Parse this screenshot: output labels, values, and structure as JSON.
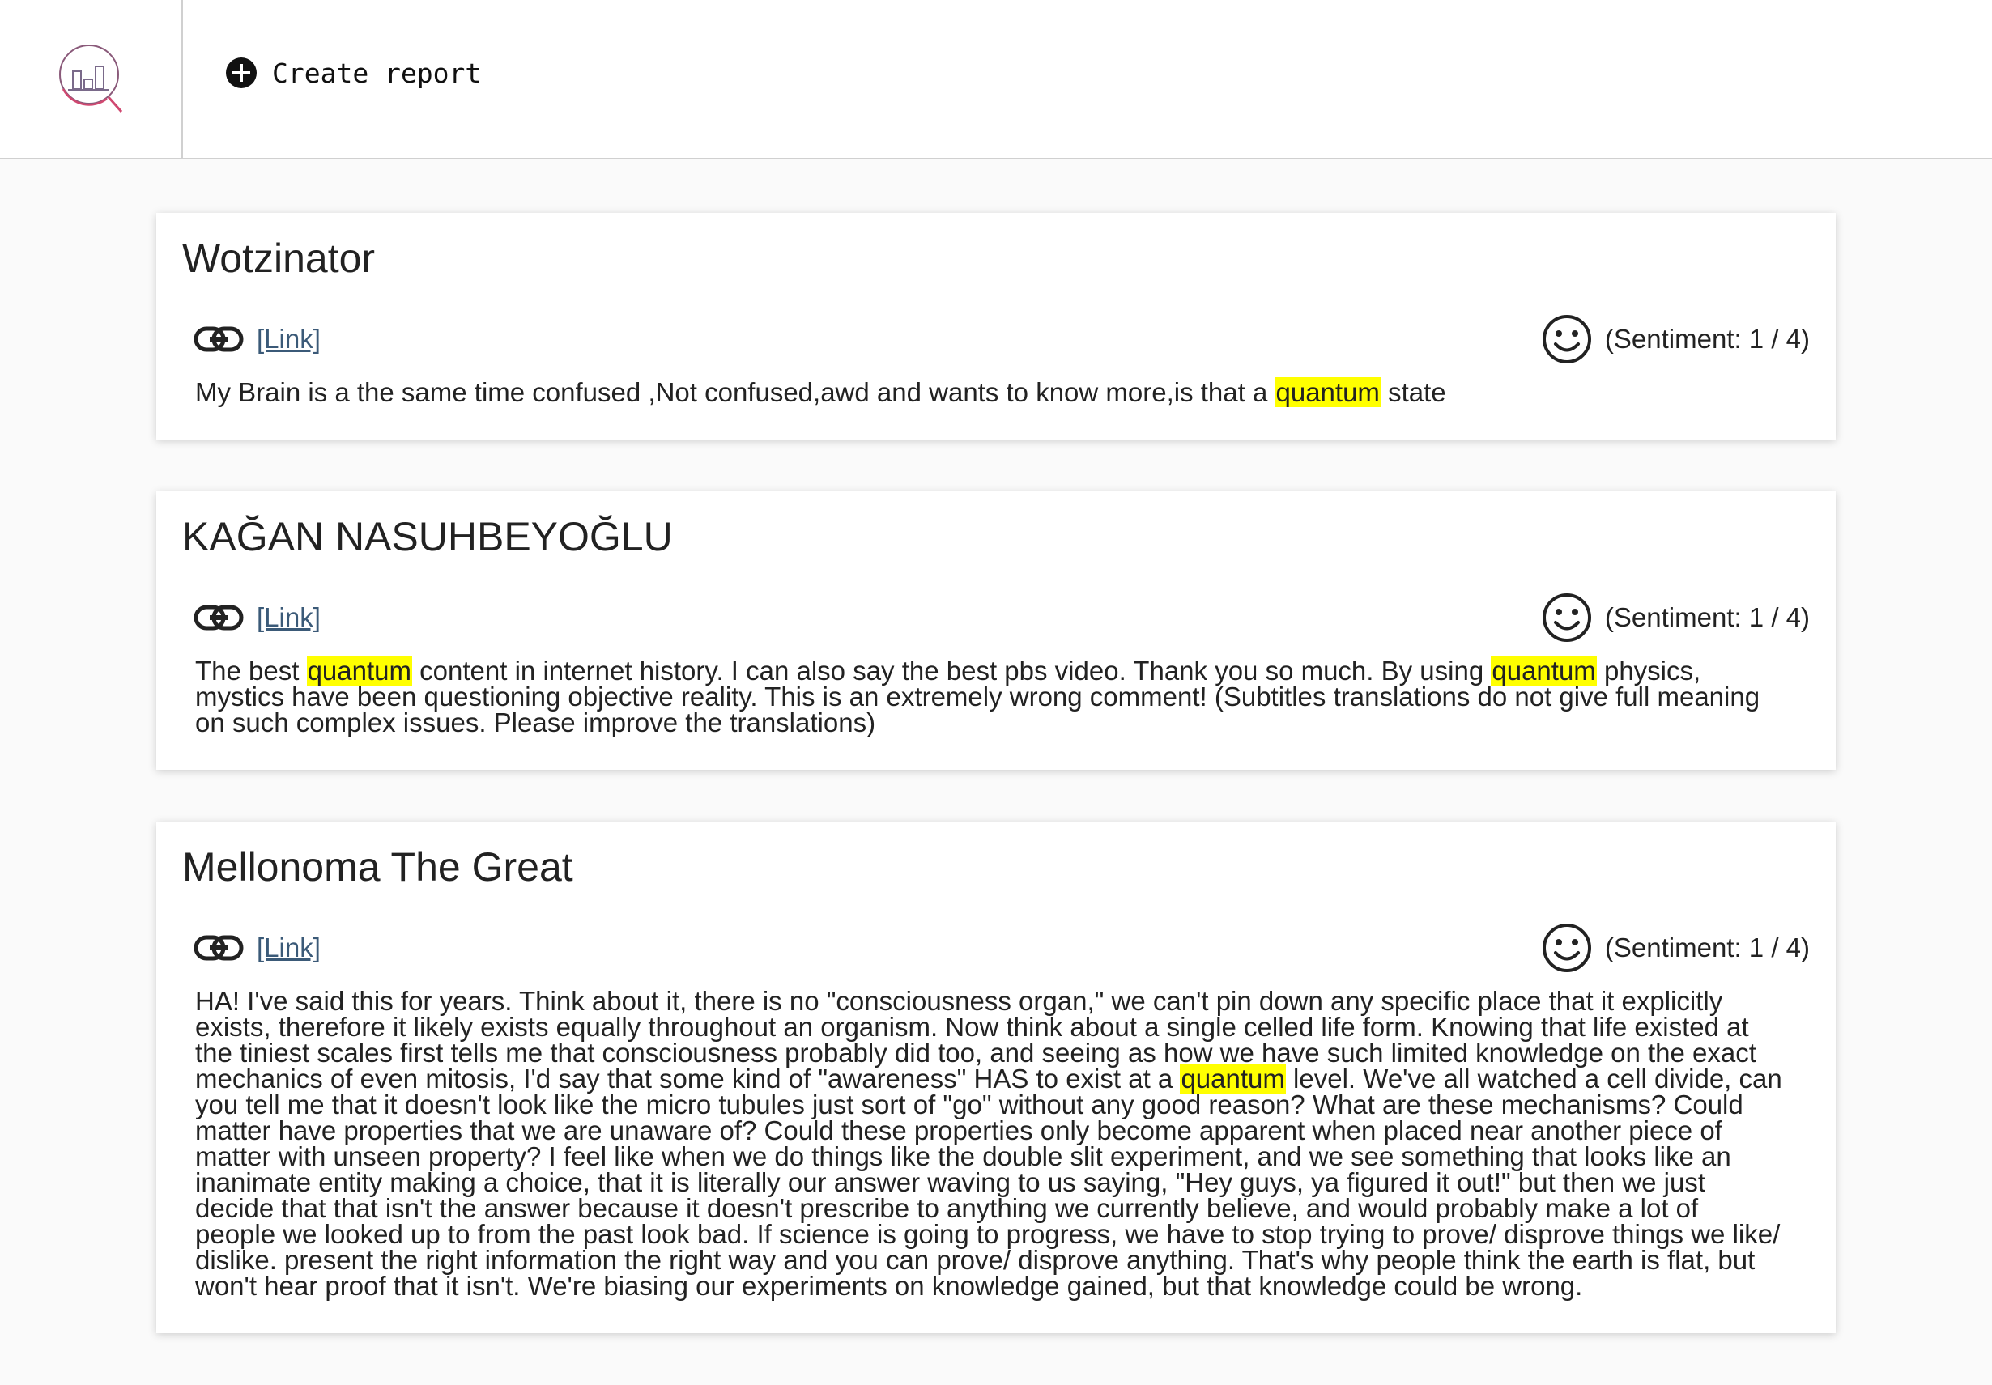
{
  "header": {
    "logo_icon": "analytics-search-icon",
    "create_icon": "plus-circle-icon",
    "create_label": "Create report"
  },
  "colors": {
    "highlight": "#ffff00",
    "link": "#3b5a78",
    "logo": "#c0567a"
  },
  "comments": [
    {
      "author": "Wotzinator",
      "link_label": "[Link]",
      "sentiment_icon": "smiley-icon",
      "sentiment": "(Sentiment: 1 / 4)",
      "body": [
        {
          "text": "My Brain is a the same time confused ,Not confused,awd and wants to know more,is that a "
        },
        {
          "text": "quantum",
          "hl": true
        },
        {
          "text": " state"
        }
      ]
    },
    {
      "author": "KAĞAN NASUHBEYOĞLU",
      "link_label": "[Link]",
      "sentiment_icon": "smiley-icon",
      "sentiment": "(Sentiment: 1 / 4)",
      "body": [
        {
          "text": "The best "
        },
        {
          "text": "quantum",
          "hl": true
        },
        {
          "text": " content in internet history. I can also say the best pbs video. Thank you so much. By using "
        },
        {
          "text": "quantum",
          "hl": true
        },
        {
          "text": " physics, mystics have been questioning objective reality. This is an extremely wrong comment! (Subtitles translations do not give full meaning on such complex issues. Please improve the translations)"
        }
      ]
    },
    {
      "author": "Mellonoma The Great",
      "link_label": "[Link]",
      "sentiment_icon": "smiley-icon",
      "sentiment": "(Sentiment: 1 / 4)",
      "body": [
        {
          "text": "HA! I've said this for years. Think about it, there is no \"consciousness organ,\" we can't pin down any specific place that it explicitly exists, therefore it likely exists equally throughout an organism. Now think about a single celled life form. Knowing that life existed at the tiniest scales first tells me that consciousness probably did too, and seeing as how we have such limited knowledge on the exact mechanics of even mitosis, I'd say that some kind of \"awareness\" HAS to exist at a "
        },
        {
          "text": "quantum",
          "hl": true
        },
        {
          "text": " level. We've all watched a cell divide, can you tell me that it doesn't look like the micro tubules just sort of \"go\" without any good reason? What are these mechanisms? Could matter have properties that we are unaware of? Could these properties only become apparent when placed near another piece of matter with unseen property? I feel like when we do things like the double slit experiment, and we see something that looks like an inanimate entity making a choice, that it is literally our answer waving to us saying, \"Hey guys, ya figured it out!\" but then we just decide that that isn't the answer because it doesn't prescribe to anything we currently believe, and would probably make a lot of people we looked up to from the past look bad. If science is going to progress, we have to stop trying to prove/ disprove things we like/ dislike. present the right information the right way and you can prove/ disprove anything. That's why people think the earth is flat, but won't hear proof that it isn't. We're biasing our experiments on knowledge gained, but that knowledge could be wrong."
        }
      ]
    }
  ]
}
